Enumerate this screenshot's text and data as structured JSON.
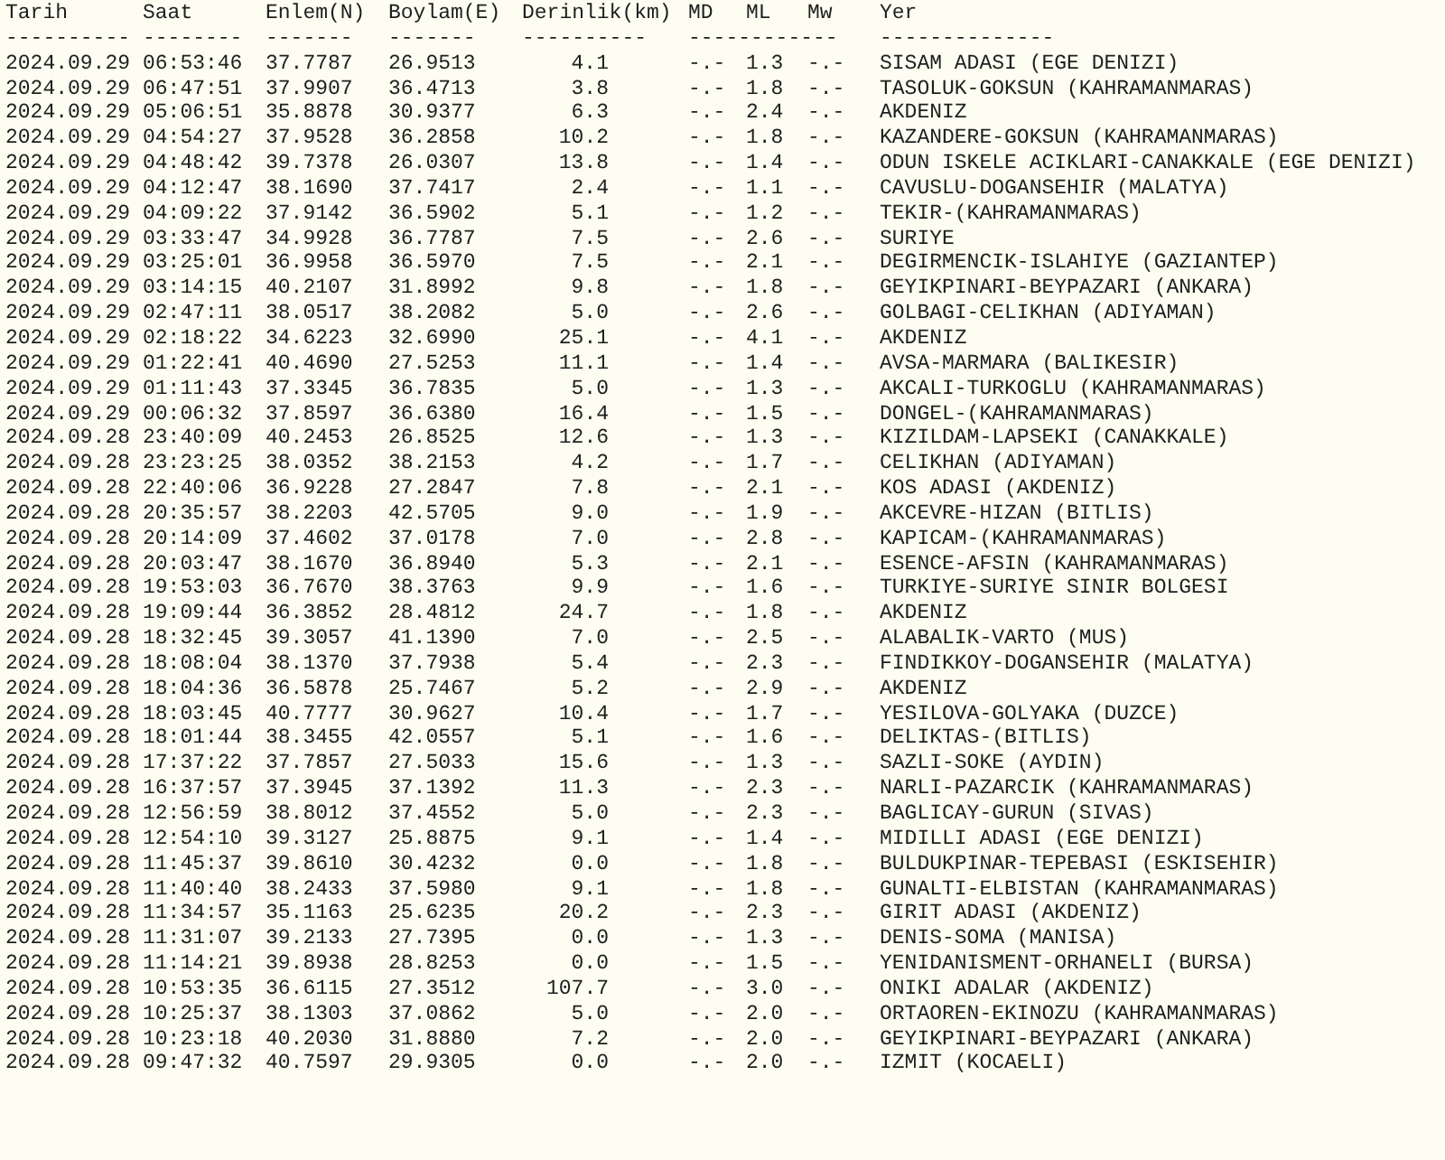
{
  "columns": [
    "Tarih",
    "Saat",
    "Enlem(N)",
    "Boylam(E)",
    "Derinlik(km)",
    "MD",
    "ML",
    "Mw",
    "Yer"
  ],
  "rules": [
    "----------",
    "--------",
    "-------",
    "-------",
    "----------",
    "------------",
    "--------------"
  ],
  "rows": [
    [
      "2024.09.29",
      "06:53:46",
      "37.7787",
      "26.9513",
      "4.1",
      "-.-",
      "1.3",
      "-.-",
      "SISAM ADASI (EGE DENIZI)"
    ],
    [
      "2024.09.29",
      "06:47:51",
      "37.9907",
      "36.4713",
      "3.8",
      "-.-",
      "1.8",
      "-.-",
      "TASOLUK-GOKSUN (KAHRAMANMARAS)"
    ],
    [
      "2024.09.29",
      "05:06:51",
      "35.8878",
      "30.9377",
      "6.3",
      "-.-",
      "2.4",
      "-.-",
      "AKDENIZ"
    ],
    [
      "2024.09.29",
      "04:54:27",
      "37.9528",
      "36.2858",
      "10.2",
      "-.-",
      "1.8",
      "-.-",
      "KAZANDERE-GOKSUN (KAHRAMANMARAS)"
    ],
    [
      "2024.09.29",
      "04:48:42",
      "39.7378",
      "26.0307",
      "13.8",
      "-.-",
      "1.4",
      "-.-",
      "ODUN ISKELE ACIKLARI-CANAKKALE (EGE DENIZI)"
    ],
    [
      "2024.09.29",
      "04:12:47",
      "38.1690",
      "37.7417",
      "2.4",
      "-.-",
      "1.1",
      "-.-",
      "CAVUSLU-DOGANSEHIR (MALATYA)"
    ],
    [
      "2024.09.29",
      "04:09:22",
      "37.9142",
      "36.5902",
      "5.1",
      "-.-",
      "1.2",
      "-.-",
      "TEKIR-(KAHRAMANMARAS)"
    ],
    [
      "2024.09.29",
      "03:33:47",
      "34.9928",
      "36.7787",
      "7.5",
      "-.-",
      "2.6",
      "-.-",
      "SURIYE"
    ],
    [
      "2024.09.29",
      "03:25:01",
      "36.9958",
      "36.5970",
      "7.5",
      "-.-",
      "2.1",
      "-.-",
      "DEGIRMENCIK-ISLAHIYE (GAZIANTEP)"
    ],
    [
      "2024.09.29",
      "03:14:15",
      "40.2107",
      "31.8992",
      "9.8",
      "-.-",
      "1.8",
      "-.-",
      "GEYIKPINARI-BEYPAZARI (ANKARA)"
    ],
    [
      "2024.09.29",
      "02:47:11",
      "38.0517",
      "38.2082",
      "5.0",
      "-.-",
      "2.6",
      "-.-",
      "GOLBAGI-CELIKHAN (ADIYAMAN)"
    ],
    [
      "2024.09.29",
      "02:18:22",
      "34.6223",
      "32.6990",
      "25.1",
      "-.-",
      "4.1",
      "-.-",
      "AKDENIZ"
    ],
    [
      "2024.09.29",
      "01:22:41",
      "40.4690",
      "27.5253",
      "11.1",
      "-.-",
      "1.4",
      "-.-",
      "AVSA-MARMARA (BALIKESIR)"
    ],
    [
      "2024.09.29",
      "01:11:43",
      "37.3345",
      "36.7835",
      "5.0",
      "-.-",
      "1.3",
      "-.-",
      "AKCALI-TURKOGLU (KAHRAMANMARAS)"
    ],
    [
      "2024.09.29",
      "00:06:32",
      "37.8597",
      "36.6380",
      "16.4",
      "-.-",
      "1.5",
      "-.-",
      "DONGEL-(KAHRAMANMARAS)"
    ],
    [
      "2024.09.28",
      "23:40:09",
      "40.2453",
      "26.8525",
      "12.6",
      "-.-",
      "1.3",
      "-.-",
      "KIZILDAM-LAPSEKI (CANAKKALE)"
    ],
    [
      "2024.09.28",
      "23:23:25",
      "38.0352",
      "38.2153",
      "4.2",
      "-.-",
      "1.7",
      "-.-",
      "CELIKHAN (ADIYAMAN)"
    ],
    [
      "2024.09.28",
      "22:40:06",
      "36.9228",
      "27.2847",
      "7.8",
      "-.-",
      "2.1",
      "-.-",
      "KOS ADASI (AKDENIZ)"
    ],
    [
      "2024.09.28",
      "20:35:57",
      "38.2203",
      "42.5705",
      "9.0",
      "-.-",
      "1.9",
      "-.-",
      "AKCEVRE-HIZAN (BITLIS)"
    ],
    [
      "2024.09.28",
      "20:14:09",
      "37.4602",
      "37.0178",
      "7.0",
      "-.-",
      "2.8",
      "-.-",
      "KAPICAM-(KAHRAMANMARAS)"
    ],
    [
      "2024.09.28",
      "20:03:47",
      "38.1670",
      "36.8940",
      "5.3",
      "-.-",
      "2.1",
      "-.-",
      "ESENCE-AFSIN (KAHRAMANMARAS)"
    ],
    [
      "2024.09.28",
      "19:53:03",
      "36.7670",
      "38.3763",
      "9.9",
      "-.-",
      "1.6",
      "-.-",
      "TURKIYE-SURIYE SINIR BOLGESI"
    ],
    [
      "2024.09.28",
      "19:09:44",
      "36.3852",
      "28.4812",
      "24.7",
      "-.-",
      "1.8",
      "-.-",
      "AKDENIZ"
    ],
    [
      "2024.09.28",
      "18:32:45",
      "39.3057",
      "41.1390",
      "7.0",
      "-.-",
      "2.5",
      "-.-",
      "ALABALIK-VARTO (MUS)"
    ],
    [
      "2024.09.28",
      "18:08:04",
      "38.1370",
      "37.7938",
      "5.4",
      "-.-",
      "2.3",
      "-.-",
      "FINDIKKOY-DOGANSEHIR (MALATYA)"
    ],
    [
      "2024.09.28",
      "18:04:36",
      "36.5878",
      "25.7467",
      "5.2",
      "-.-",
      "2.9",
      "-.-",
      "AKDENIZ"
    ],
    [
      "2024.09.28",
      "18:03:45",
      "40.7777",
      "30.9627",
      "10.4",
      "-.-",
      "1.7",
      "-.-",
      "YESILOVA-GOLYAKA (DUZCE)"
    ],
    [
      "2024.09.28",
      "18:01:44",
      "38.3455",
      "42.0557",
      "5.1",
      "-.-",
      "1.6",
      "-.-",
      "DELIKTAS-(BITLIS)"
    ],
    [
      "2024.09.28",
      "17:37:22",
      "37.7857",
      "27.5033",
      "15.6",
      "-.-",
      "1.3",
      "-.-",
      "SAZLI-SOKE (AYDIN)"
    ],
    [
      "2024.09.28",
      "16:37:57",
      "37.3945",
      "37.1392",
      "11.3",
      "-.-",
      "2.3",
      "-.-",
      "NARLI-PAZARCIK (KAHRAMANMARAS)"
    ],
    [
      "2024.09.28",
      "12:56:59",
      "38.8012",
      "37.4552",
      "5.0",
      "-.-",
      "2.3",
      "-.-",
      "BAGLICAY-GURUN (SIVAS)"
    ],
    [
      "2024.09.28",
      "12:54:10",
      "39.3127",
      "25.8875",
      "9.1",
      "-.-",
      "1.4",
      "-.-",
      "MIDILLI ADASI (EGE DENIZI)"
    ],
    [
      "2024.09.28",
      "11:45:37",
      "39.8610",
      "30.4232",
      "0.0",
      "-.-",
      "1.8",
      "-.-",
      "BULDUKPINAR-TEPEBASI (ESKISEHIR)"
    ],
    [
      "2024.09.28",
      "11:40:40",
      "38.2433",
      "37.5980",
      "9.1",
      "-.-",
      "1.8",
      "-.-",
      "GUNALTI-ELBISTAN (KAHRAMANMARAS)"
    ],
    [
      "2024.09.28",
      "11:34:57",
      "35.1163",
      "25.6235",
      "20.2",
      "-.-",
      "2.3",
      "-.-",
      "GIRIT ADASI (AKDENIZ)"
    ],
    [
      "2024.09.28",
      "11:31:07",
      "39.2133",
      "27.7395",
      "0.0",
      "-.-",
      "1.3",
      "-.-",
      "DENIS-SOMA (MANISA)"
    ],
    [
      "2024.09.28",
      "11:14:21",
      "39.8938",
      "28.8253",
      "0.0",
      "-.-",
      "1.5",
      "-.-",
      "YENIDANISMENT-ORHANELI (BURSA)"
    ],
    [
      "2024.09.28",
      "10:53:35",
      "36.6115",
      "27.3512",
      "107.7",
      "-.-",
      "3.0",
      "-.-",
      "ONIKI ADALAR (AKDENIZ)"
    ],
    [
      "2024.09.28",
      "10:25:37",
      "38.1303",
      "37.0862",
      "5.0",
      "-.-",
      "2.0",
      "-.-",
      "ORTAOREN-EKINOZU (KAHRAMANMARAS)"
    ],
    [
      "2024.09.28",
      "10:23:18",
      "40.2030",
      "31.8880",
      "7.2",
      "-.-",
      "2.0",
      "-.-",
      "GEYIKPINARI-BEYPAZARI (ANKARA)"
    ],
    [
      "2024.09.28",
      "09:47:32",
      "40.7597",
      "29.9305",
      "0.0",
      "-.-",
      "2.0",
      "-.-",
      "IZMIT (KOCAELI)"
    ]
  ]
}
